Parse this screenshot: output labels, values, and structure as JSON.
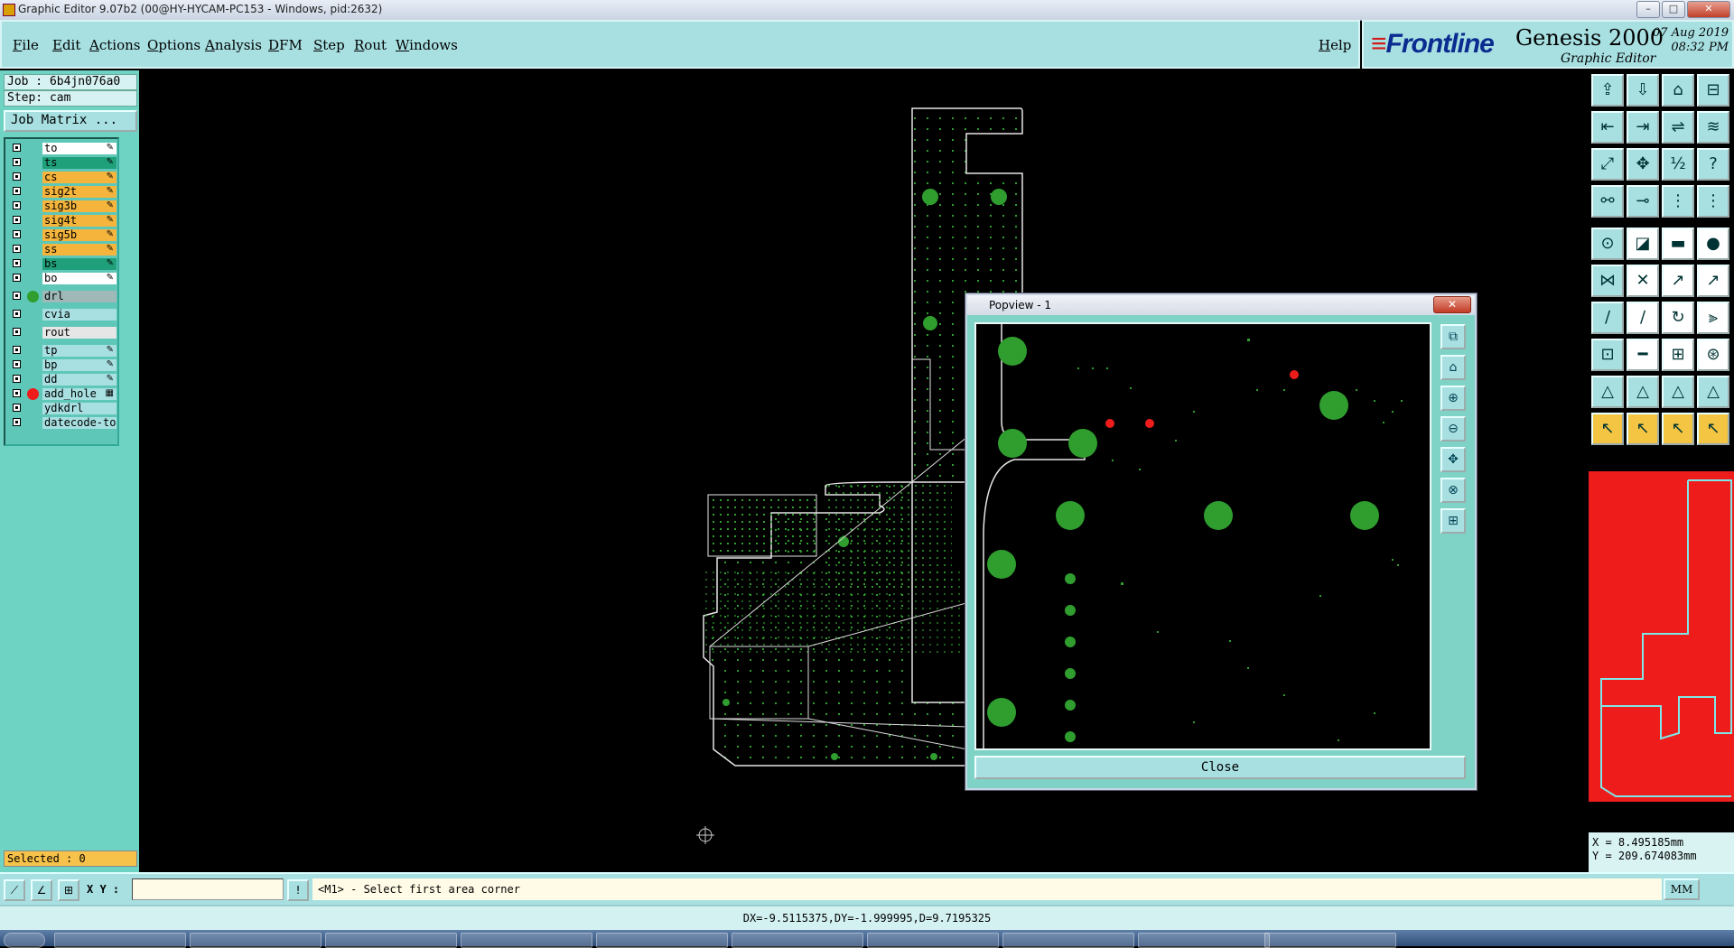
{
  "window": {
    "title": "Graphic Editor 9.07b2 (00@HY-HYCAM-PC153 - Windows, pid:2632)",
    "controls": [
      "–",
      "□",
      "✕"
    ]
  },
  "menu": [
    "File",
    "Edit",
    "Actions",
    "Options",
    "Analysis",
    "DFM",
    "Step",
    "Rout",
    "Windows"
  ],
  "help_label": "Help",
  "brand": {
    "logo": "Frontline",
    "product": "Genesis 2000",
    "subtitle": "Graphic Editor",
    "date": "07 Aug 2019",
    "time": "08:32 PM"
  },
  "left_panel": {
    "job": "Job : 6b4jn076a0",
    "step": "Step: cam",
    "job_matrix_label": "Job Matrix ...",
    "layers": [
      {
        "name": "to",
        "bg": "#ffffff",
        "dot": "",
        "sym": "✎"
      },
      {
        "name": "ts",
        "bg": "#20a07a",
        "dot": "",
        "sym": "✎"
      },
      {
        "name": "cs",
        "bg": "#f5b43c",
        "dot": "",
        "sym": "✎"
      },
      {
        "name": "sig2t",
        "bg": "#f5b43c",
        "dot": "",
        "sym": "✎"
      },
      {
        "name": "sig3b",
        "bg": "#f5b43c",
        "dot": "",
        "sym": "✎"
      },
      {
        "name": "sig4t",
        "bg": "#f5b43c",
        "dot": "",
        "sym": "✎"
      },
      {
        "name": "sig5b",
        "bg": "#f5b43c",
        "dot": "",
        "sym": "✎"
      },
      {
        "name": "ss",
        "bg": "#f5b43c",
        "dot": "",
        "sym": "✎"
      },
      {
        "name": "bs",
        "bg": "#20a07a",
        "dot": "",
        "sym": "✎"
      },
      {
        "name": "bo",
        "bg": "#ffffff",
        "dot": "",
        "sym": "✎"
      },
      {
        "name": "drl",
        "bg": "#9fb8b8",
        "dot": "#2f9e2f",
        "sym": ""
      },
      {
        "name": "cvia",
        "bg": "#a8e0e2",
        "dot": "",
        "sym": ""
      },
      {
        "name": "rout",
        "bg": "#e6e6e6",
        "dot": "",
        "sym": ""
      },
      {
        "name": "tp",
        "bg": "#a8e0e2",
        "dot": "",
        "sym": "✎"
      },
      {
        "name": "bp",
        "bg": "#a8e0e2",
        "dot": "",
        "sym": "✎"
      },
      {
        "name": "dd",
        "bg": "#a8e0e2",
        "dot": "",
        "sym": "✎"
      },
      {
        "name": "add_hole",
        "bg": "#a8e0e2",
        "dot": "#ef1c1c",
        "sym": "▦"
      },
      {
        "name": "ydkdrl",
        "bg": "#a8e0e2",
        "dot": "",
        "sym": ""
      },
      {
        "name": "datecode-to",
        "bg": "#a8e0e2",
        "dot": "",
        "sym": ""
      }
    ],
    "selected": "Selected : 0"
  },
  "popview": {
    "title": "Popview - 1",
    "close_label": "Close",
    "tool_icons": [
      "zoom-fit-icon",
      "home-icon",
      "zoom-in-icon",
      "zoom-out-icon",
      "pan-icon",
      "center-icon",
      "fit-icon"
    ]
  },
  "right_tools": [
    "open-icon",
    "save-icon",
    "home-icon",
    "window-icon",
    "step-in-icon",
    "step-out-icon",
    "layer-icon",
    "line-icon",
    "fit-icon",
    "center-icon",
    "scale-icon",
    "help-icon",
    "measure-icon",
    "probe-icon",
    "snap-icon",
    "grid-icon",
    "pad-icon",
    "line-draw-icon",
    "surface-icon",
    "circle-icon",
    "connect-icon",
    "cross-icon",
    "move-icon",
    "copy-icon",
    "arc-icon",
    "rotate-icon",
    "undo-icon",
    "mirror-icon",
    "attr-icon",
    "break-icon",
    "resize-icon",
    "contour-icon",
    "text-icon",
    "poly-icon",
    "arc-poly-icon",
    "slot-icon",
    "select-icon",
    "select-area-icon",
    "select-net-icon",
    "select-multi-icon"
  ],
  "coordinates": {
    "x": "X = 8.495185mm",
    "y": "Y = 209.674083mm"
  },
  "command_bar": {
    "xy_label": "X Y :",
    "xy_value": "",
    "prompt": "<M1> - Select first area corner",
    "units": "MM"
  },
  "status": "DX=-9.5115375,DY=-1.999995,D=9.7195325",
  "colors": {
    "panel": "#a8e0e2",
    "side": "#6fd3c4",
    "pcb_green": "#2f9e2f",
    "highlight_red": "#ef1c1c"
  }
}
